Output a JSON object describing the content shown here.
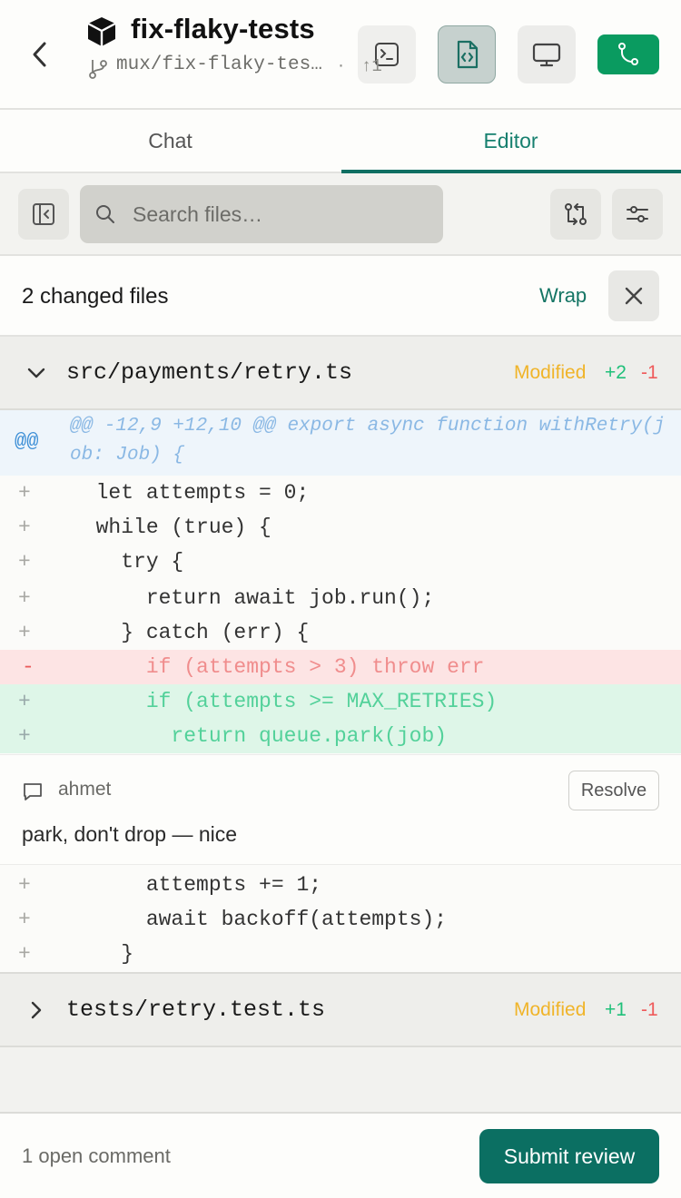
{
  "header": {
    "title": "fix-flaky-tests",
    "branch": "mux/fix-flaky-tests",
    "separator": "·",
    "ahead": "↑1",
    "icons": [
      "back-icon",
      "workspace-logo-icon",
      "branch-icon",
      "terminal-icon",
      "code-file-icon",
      "monitor-icon",
      "git-merge-icon"
    ]
  },
  "tabs": [
    {
      "label": "Chat",
      "active": false
    },
    {
      "label": "Editor",
      "active": true
    }
  ],
  "toolbar": {
    "search_placeholder": "Search files…"
  },
  "changed": {
    "count_label": "2 changed files",
    "wrap_label": "Wrap"
  },
  "files": [
    {
      "name": "src/payments/retry.ts",
      "status": "Modified",
      "additions": "+2",
      "deletions": "-1",
      "expanded": true,
      "hunk_marker": "@@",
      "hunk_header": "@@ -12,9 +12,10 @@ export async function withRetry(job: Job) {",
      "lines": [
        {
          "type": "context",
          "marker": "+",
          "code": "  let attempts = 0;"
        },
        {
          "type": "context",
          "marker": "+",
          "code": "  while (true) {"
        },
        {
          "type": "context",
          "marker": "+",
          "code": "    try {"
        },
        {
          "type": "context",
          "marker": "+",
          "code": "      return await job.run();"
        },
        {
          "type": "context",
          "marker": "+",
          "code": "    } catch (err) {"
        },
        {
          "type": "del",
          "marker": "-",
          "code": "      if (attempts > 3) throw err"
        },
        {
          "type": "add",
          "marker": "+",
          "code": "      if (attempts >= MAX_RETRIES)"
        },
        {
          "type": "add",
          "marker": "+",
          "code": "        return queue.park(job)"
        }
      ],
      "comment": {
        "author": "ahmet",
        "body": "park, don't drop — nice",
        "resolve_label": "Resolve"
      },
      "after_lines": [
        {
          "type": "context",
          "marker": "+",
          "code": "      attempts += 1;"
        },
        {
          "type": "context",
          "marker": "+",
          "code": "      await backoff(attempts);"
        },
        {
          "type": "context",
          "marker": "+",
          "code": "    }"
        }
      ]
    },
    {
      "name": "tests/retry.test.ts",
      "status": "Modified",
      "additions": "+1",
      "deletions": "-1",
      "expanded": false
    }
  ],
  "footer": {
    "open_comments": "1 open comment",
    "submit_label": "Submit review"
  },
  "colors": {
    "accent": "#0b6f62",
    "git_button": "#0a9b60",
    "modified": "#f0b429",
    "additions": "#20c07a",
    "deletions": "#ef5b5b"
  }
}
